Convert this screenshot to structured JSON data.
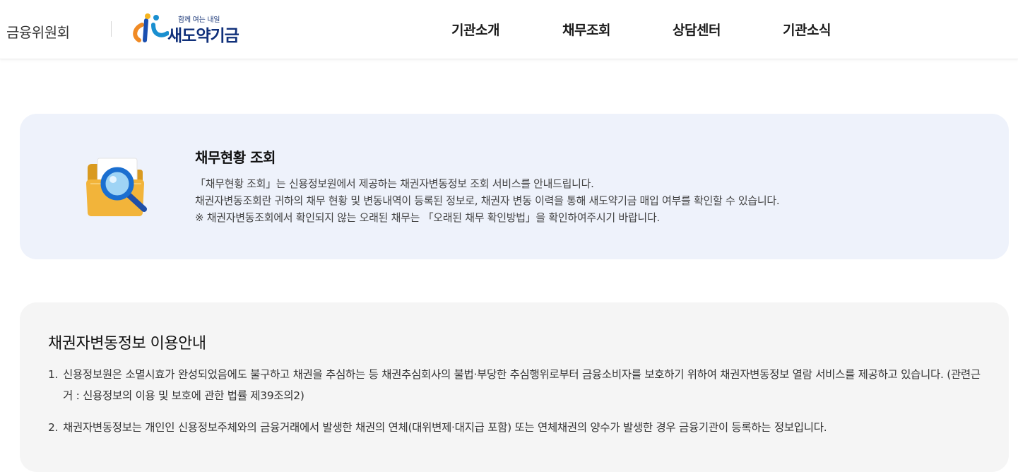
{
  "header": {
    "org": "금융위원회",
    "logo": {
      "tagline": "함께 여는 내일",
      "name": "새도약기금"
    },
    "nav": [
      "기관소개",
      "채무조회",
      "상담센터",
      "기관소식"
    ]
  },
  "intro": {
    "icon": "folder-search-icon",
    "title": "채무현황 조회",
    "lines": [
      "「채무현황 조회」는 신용정보원에서 제공하는 채권자변동정보 조회 서비스를 안내드립니다.",
      "채권자변동조회란 귀하의 채무 현황 및 변동내역이 등록된 정보로, 채권자 변동 이력을 통해 새도약기금 매입 여부를 확인할 수 있습니다.",
      "※ 채권자변동조회에서 확인되지 않는 오래된 채무는 「오래된 채무 확인방법」을 확인하여주시기 바랍니다."
    ]
  },
  "guide": {
    "title": "채권자변동정보 이용안내",
    "items": [
      {
        "num": "1.",
        "text": "신용정보원은 소멸시효가 완성되었음에도 불구하고 채권을 추심하는 등 채권추심회사의 불법·부당한 추심행위로부터 금융소비자를 보호하기 위하여 채권자변동정보 열람 서비스를 제공하고 있습니다. (관련근거 : 신용정보의 이용 및 보호에 관한 법률 제39조의2)"
      },
      {
        "num": "2.",
        "text": "채권자변동정보는 개인인 신용정보주체와의 금융거래에서 발생한 채권의 연체(대위변제·대지급 포함) 또는 연체채권의 양수가 발생한 경우 금융기관이 등록하는 정보입니다."
      }
    ]
  },
  "colors": {
    "brand_navy": "#10307a",
    "intro_bg": "#eef2fb",
    "guide_bg": "#f5f5f5"
  }
}
